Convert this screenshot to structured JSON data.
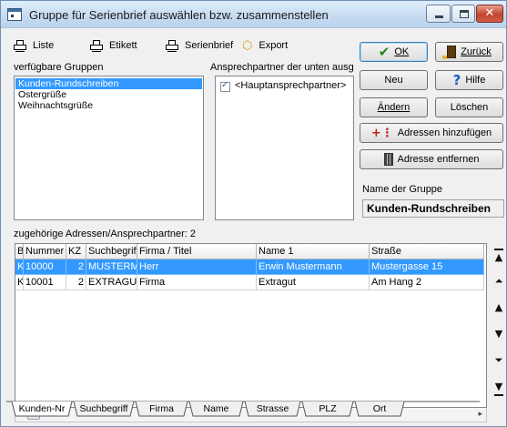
{
  "window": {
    "title": "Gruppe für Serienbrief auswählen bzw. zusammenstellen"
  },
  "toolbar": {
    "liste": "Liste",
    "etikett": "Etikett",
    "serienbrief": "Serienbrief",
    "export": "Export"
  },
  "groups": {
    "label": "verfügbare Gruppen",
    "items": [
      "Kunden-Rundschreiben",
      "Ostergrüße",
      "Weihnachtsgrüße"
    ],
    "selected": "Kunden-Rundschreiben"
  },
  "contacts": {
    "label": "Ansprechpartner der unten ausg",
    "items": [
      {
        "label": "<Hauptansprechpartner>",
        "checked": true
      }
    ]
  },
  "buttons": {
    "ok": "OK",
    "zurueck": "Zurück",
    "neu": "Neu",
    "hilfe": "Hilfe",
    "aendern": "Ändern",
    "loeschen": "Löschen",
    "adressen_hinzufuegen": "Adressen hinzufügen",
    "adresse_entfernen": "Adresse entfernen"
  },
  "group_name": {
    "label": "Name der Gruppe",
    "value": "Kunden-Rundschreiben"
  },
  "addresses": {
    "summary": "zugehörige Adressen/Ansprechpartner: 2",
    "columns": [
      "B",
      "Nummer",
      "KZ",
      "Suchbegriff",
      "Firma / Titel",
      "Name 1",
      "Straße"
    ],
    "rows": [
      [
        "K",
        "10000",
        "2",
        "MUSTERMA",
        "Herr",
        "Erwin Mustermann",
        "Mustergasse 15"
      ],
      [
        "K",
        "10001",
        "2",
        "EXTRAGUT",
        "Firma",
        "Extragut",
        "Am Hang 2"
      ]
    ],
    "selected_row": 0
  },
  "sort_tabs": [
    "Kunden-Nr",
    "Suchbegriff",
    "Firma",
    "Name",
    "Strasse",
    "PLZ",
    "Ort"
  ],
  "active_tab": "Kunden-Nr",
  "colors": {
    "selection": "#3399ff",
    "window_bg": "#f0f0f0"
  }
}
